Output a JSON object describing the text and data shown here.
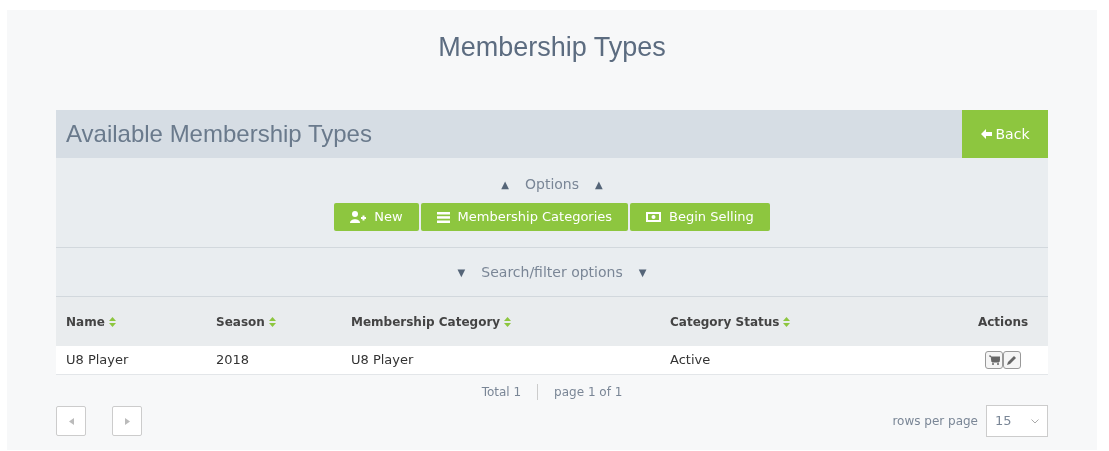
{
  "page_title": "Membership Types",
  "panel": {
    "title": "Available Membership Types",
    "back_button": "Back"
  },
  "options": {
    "label": "Options",
    "arrow": "▲",
    "buttons": [
      {
        "kind": "new",
        "label": "New"
      },
      {
        "kind": "list",
        "label": "Membership Categories"
      },
      {
        "kind": "money",
        "label": "Begin Selling"
      }
    ]
  },
  "search_filter": {
    "label": "Search/filter options",
    "arrow": "▼"
  },
  "table": {
    "columns": [
      {
        "label": "Name",
        "sortable": true
      },
      {
        "label": "Season",
        "sortable": true
      },
      {
        "label": "Membership Category",
        "sortable": true
      },
      {
        "label": "Category Status",
        "sortable": true
      },
      {
        "label": "Actions",
        "sortable": false
      }
    ],
    "rows": [
      {
        "cells": [
          "U8 Player",
          "2018",
          "U8 Player",
          "Active"
        ]
      }
    ]
  },
  "footer": {
    "total": "Total 1",
    "page": "page 1 of 1",
    "rows_per_page_label": "rows per page",
    "rows_per_page": "15"
  }
}
